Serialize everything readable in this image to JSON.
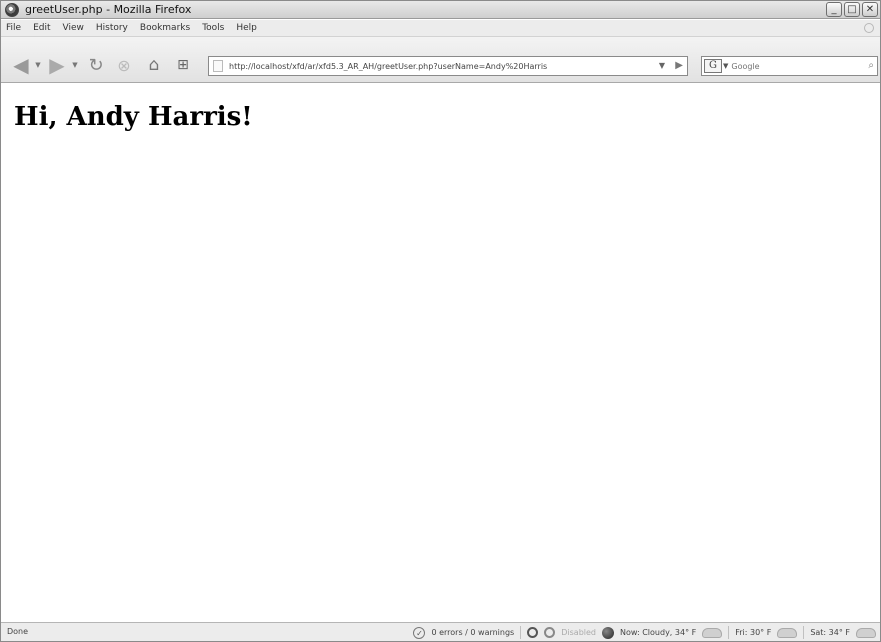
{
  "window": {
    "title": "greetUser.php - Mozilla Firefox",
    "buttons": {
      "minimize": "_",
      "maximize": "□",
      "close": "✕"
    }
  },
  "menu": {
    "items": [
      "File",
      "Edit",
      "View",
      "History",
      "Bookmarks",
      "Tools",
      "Help"
    ]
  },
  "toolbar": {
    "url": "http://localhost/xfd/ar/xfd5.3_AR_AH/greetUser.php?userName=Andy%20Harris",
    "search_engine_letter": "G",
    "search_placeholder": "Google"
  },
  "page": {
    "heading": "Hi, Andy Harris!"
  },
  "status": {
    "left_text": "Done",
    "errors": "0 errors / 0 warnings",
    "disabled": "Disabled",
    "weather_now": "Now: Cloudy, 34° F",
    "weather_fri": "Fri: 30° F",
    "weather_sat": "Sat: 34° F"
  },
  "icons": [
    "firefox-icon",
    "back-arrow-icon",
    "forward-arrow-icon",
    "reload-icon",
    "stop-icon",
    "home-icon",
    "new-tab-icon",
    "page-icon",
    "go-arrow-icon",
    "google-icon",
    "search-magnifier-icon",
    "check-icon",
    "globe-icon",
    "cloud-icon"
  ]
}
